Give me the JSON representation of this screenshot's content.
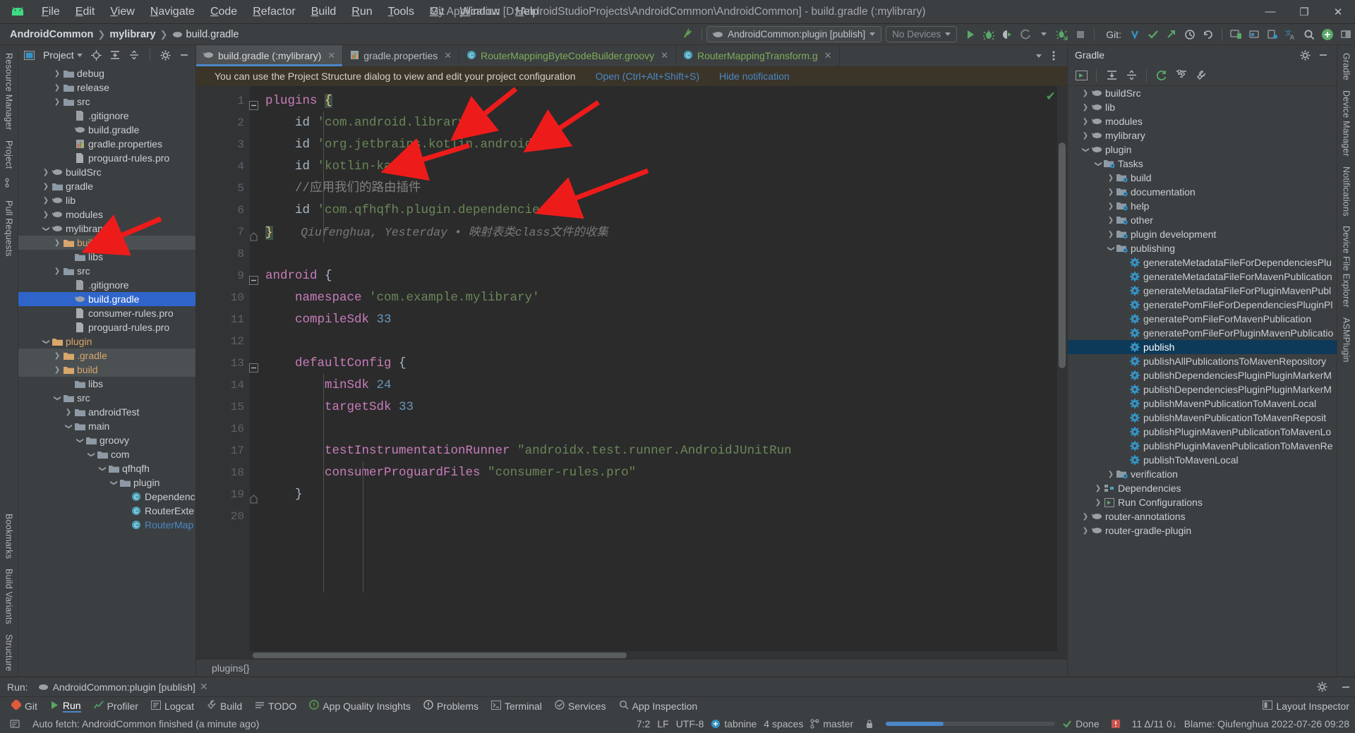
{
  "window": {
    "title": "My Application [D:\\AndroidStudioProjects\\AndroidCommon\\AndroidCommon] - build.gradle (:mylibrary)",
    "minimize": "—",
    "maximize": "❐",
    "close": "✕",
    "logo_icon": "android-logo-icon"
  },
  "menubar": [
    {
      "label": "File"
    },
    {
      "label": "Edit"
    },
    {
      "label": "View"
    },
    {
      "label": "Navigate"
    },
    {
      "label": "Code"
    },
    {
      "label": "Refactor"
    },
    {
      "label": "Build"
    },
    {
      "label": "Run"
    },
    {
      "label": "Tools"
    },
    {
      "label": "Git"
    },
    {
      "label": "Window"
    },
    {
      "label": "Help"
    }
  ],
  "breadcrumb": [
    {
      "label": "AndroidCommon"
    },
    {
      "label": "mylibrary"
    },
    {
      "label": "build.gradle"
    }
  ],
  "toolbar": {
    "run_config": "AndroidCommon:plugin [publish]",
    "devices": "No Devices",
    "git_label": "Git:",
    "icons": [
      "run-icon",
      "debug-icon",
      "run-coverage-icon",
      "profiler-icon",
      "attach-debugger-icon",
      "stop-icon",
      "git-update-icon",
      "git-commit-icon",
      "git-push-icon",
      "history-icon",
      "undo-icon",
      "search-everywhere-icon",
      "avd-manager-icon",
      "sdk-manager-icon",
      "translate-icon",
      "search-icon",
      "plus-icon",
      "layout-icon"
    ]
  },
  "left_rail": {
    "top": [
      "Resource Manager",
      "Project"
    ],
    "middle": [
      "Pull Requests"
    ],
    "bottom": [
      "Bookmarks",
      "Build Variants",
      "Structure"
    ]
  },
  "right_rail": [
    "Gradle",
    "Device Manager",
    "Notifications",
    "Device File Explorer",
    "ASMPlugin"
  ],
  "project_panel": {
    "title": "Project",
    "tree": [
      {
        "label": "debug",
        "indent": 3,
        "arrow": "collapsed",
        "icon": "folder-icon",
        "state": "normal"
      },
      {
        "label": "release",
        "indent": 3,
        "arrow": "collapsed",
        "icon": "folder-icon",
        "state": "normal"
      },
      {
        "label": "src",
        "indent": 3,
        "arrow": "collapsed",
        "icon": "folder-icon",
        "state": "normal"
      },
      {
        "label": ".gitignore",
        "indent": 4,
        "arrow": "none",
        "icon": "gitignore-icon",
        "state": "normal"
      },
      {
        "label": "build.gradle",
        "indent": 4,
        "arrow": "none",
        "icon": "gradle-icon",
        "state": "normal"
      },
      {
        "label": "gradle.properties",
        "indent": 4,
        "arrow": "none",
        "icon": "properties-icon",
        "state": "normal"
      },
      {
        "label": "proguard-rules.pro",
        "indent": 4,
        "arrow": "none",
        "icon": "file-icon",
        "state": "normal"
      },
      {
        "label": "buildSrc",
        "indent": 2,
        "arrow": "collapsed",
        "icon": "module-icon",
        "state": "normal"
      },
      {
        "label": "gradle",
        "indent": 2,
        "arrow": "collapsed",
        "icon": "folder-icon",
        "state": "normal"
      },
      {
        "label": "lib",
        "indent": 2,
        "arrow": "collapsed",
        "icon": "module-icon",
        "state": "normal"
      },
      {
        "label": "modules",
        "indent": 2,
        "arrow": "collapsed",
        "icon": "module-icon",
        "state": "normal"
      },
      {
        "label": "mylibrary",
        "indent": 2,
        "arrow": "expanded",
        "icon": "module-icon",
        "state": "normal"
      },
      {
        "label": "build",
        "indent": 3,
        "arrow": "collapsed",
        "icon": "folder-orange-icon",
        "state": "highlight"
      },
      {
        "label": "libs",
        "indent": 4,
        "arrow": "none",
        "icon": "folder-icon",
        "state": "normal"
      },
      {
        "label": "src",
        "indent": 3,
        "arrow": "collapsed",
        "icon": "folder-icon",
        "state": "normal"
      },
      {
        "label": ".gitignore",
        "indent": 4,
        "arrow": "none",
        "icon": "gitignore-icon",
        "state": "normal"
      },
      {
        "label": "build.gradle",
        "indent": 4,
        "arrow": "none",
        "icon": "gradle-icon",
        "state": "selected"
      },
      {
        "label": "consumer-rules.pro",
        "indent": 4,
        "arrow": "none",
        "icon": "file-icon",
        "state": "normal"
      },
      {
        "label": "proguard-rules.pro",
        "indent": 4,
        "arrow": "none",
        "icon": "file-icon",
        "state": "normal"
      },
      {
        "label": "plugin",
        "indent": 2,
        "arrow": "expanded",
        "icon": "folder-orange-icon",
        "state": "normal"
      },
      {
        "label": ".gradle",
        "indent": 3,
        "arrow": "collapsed",
        "icon": "folder-orange-icon",
        "state": "highlight"
      },
      {
        "label": "build",
        "indent": 3,
        "arrow": "collapsed",
        "icon": "folder-orange-icon",
        "state": "highlight"
      },
      {
        "label": "libs",
        "indent": 4,
        "arrow": "none",
        "icon": "folder-icon",
        "state": "normal"
      },
      {
        "label": "src",
        "indent": 3,
        "arrow": "expanded",
        "icon": "folder-icon",
        "state": "normal"
      },
      {
        "label": "androidTest",
        "indent": 4,
        "arrow": "collapsed",
        "icon": "folder-icon",
        "state": "normal"
      },
      {
        "label": "main",
        "indent": 4,
        "arrow": "expanded",
        "icon": "folder-icon",
        "state": "normal"
      },
      {
        "label": "groovy",
        "indent": 5,
        "arrow": "expanded",
        "icon": "folder-icon",
        "state": "normal"
      },
      {
        "label": "com",
        "indent": 6,
        "arrow": "expanded",
        "icon": "folder-icon",
        "state": "normal"
      },
      {
        "label": "qfhqfh",
        "indent": 7,
        "arrow": "expanded",
        "icon": "folder-icon",
        "state": "normal"
      },
      {
        "label": "plugin",
        "indent": 8,
        "arrow": "expanded",
        "icon": "folder-icon",
        "state": "normal"
      },
      {
        "label": "Dependenc",
        "indent": 9,
        "arrow": "none",
        "icon": "class-icon",
        "state": "normal"
      },
      {
        "label": "RouterExte",
        "indent": 9,
        "arrow": "none",
        "icon": "class-icon",
        "state": "normal"
      },
      {
        "label": "RouterMap",
        "indent": 9,
        "arrow": "none",
        "icon": "class-icon",
        "state": "link"
      }
    ]
  },
  "editor_tabs": [
    {
      "label": "build.gradle (:mylibrary)",
      "icon": "gradle-icon",
      "active": true,
      "color": "normal"
    },
    {
      "label": "gradle.properties",
      "icon": "properties-icon",
      "active": false,
      "color": "normal"
    },
    {
      "label": "RouterMappingByteCodeBuilder.groovy",
      "icon": "class-icon",
      "active": false,
      "color": "groovy"
    },
    {
      "label": "RouterMappingTransform.g",
      "icon": "class-icon",
      "active": false,
      "color": "groovy"
    }
  ],
  "notification": {
    "text": "You can use the Project Structure dialog to view and edit your project configuration",
    "open_link": "Open (Ctrl+Alt+Shift+S)",
    "hide_link": "Hide notification"
  },
  "code": {
    "lines": [
      {
        "n": "1",
        "segments": [
          {
            "t": "plugins ",
            "c": "pl"
          },
          {
            "t": "{",
            "c": "brace-hl"
          }
        ],
        "fold": "expanded"
      },
      {
        "n": "2",
        "segments": [
          {
            "t": "    id ",
            "c": "kw-id"
          },
          {
            "t": "'com.android.library'",
            "c": "str"
          }
        ]
      },
      {
        "n": "3",
        "segments": [
          {
            "t": "    id ",
            "c": "kw-id"
          },
          {
            "t": "'org.jetbrains.kotlin.android'",
            "c": "str"
          }
        ]
      },
      {
        "n": "4",
        "segments": [
          {
            "t": "    id ",
            "c": "kw-id"
          },
          {
            "t": "'kotlin-kapt'",
            "c": "str"
          }
        ]
      },
      {
        "n": "5",
        "segments": [
          {
            "t": "    //应用我们的路由插件",
            "c": "cmt"
          }
        ]
      },
      {
        "n": "6",
        "segments": [
          {
            "t": "    id ",
            "c": "kw-id"
          },
          {
            "t": "'com.qfhqfh.plugin.dependencies'",
            "c": "str"
          }
        ]
      },
      {
        "n": "7",
        "segments": [
          {
            "t": "}",
            "c": "brace-hl"
          },
          {
            "t": "    Qiufenghua, Yesterday • 映射表类class文件的收集",
            "c": "blame"
          }
        ],
        "fold": "end"
      },
      {
        "n": "8",
        "segments": []
      },
      {
        "n": "9",
        "segments": [
          {
            "t": "android ",
            "c": "pl"
          },
          {
            "t": "{",
            "c": "plain"
          }
        ],
        "fold": "expanded"
      },
      {
        "n": "10",
        "segments": [
          {
            "t": "    namespace ",
            "c": "pl"
          },
          {
            "t": "'com.example.mylibrary'",
            "c": "str"
          }
        ]
      },
      {
        "n": "11",
        "segments": [
          {
            "t": "    compileSdk ",
            "c": "pl"
          },
          {
            "t": "33",
            "c": "num"
          }
        ]
      },
      {
        "n": "12",
        "segments": []
      },
      {
        "n": "13",
        "segments": [
          {
            "t": "    defaultConfig ",
            "c": "pl"
          },
          {
            "t": "{",
            "c": "plain"
          }
        ],
        "fold": "expanded"
      },
      {
        "n": "14",
        "segments": [
          {
            "t": "        minSdk ",
            "c": "pl"
          },
          {
            "t": "24",
            "c": "num"
          }
        ]
      },
      {
        "n": "15",
        "segments": [
          {
            "t": "        targetSdk ",
            "c": "pl"
          },
          {
            "t": "33",
            "c": "num"
          }
        ]
      },
      {
        "n": "16",
        "segments": []
      },
      {
        "n": "17",
        "segments": [
          {
            "t": "        testInstrumentationRunner ",
            "c": "pl"
          },
          {
            "t": "\"androidx.test.runner.AndroidJUnitRun",
            "c": "str"
          }
        ]
      },
      {
        "n": "18",
        "segments": [
          {
            "t": "        consumerProguardFiles ",
            "c": "pl"
          },
          {
            "t": "\"consumer-rules.pro\"",
            "c": "str"
          }
        ]
      },
      {
        "n": "19",
        "segments": [
          {
            "t": "    }",
            "c": "plain"
          }
        ],
        "fold": "end"
      },
      {
        "n": "20",
        "segments": []
      }
    ],
    "breadcrumb": "plugins{}"
  },
  "gradle_panel": {
    "title": "Gradle",
    "tools": [
      "execute-task-icon",
      "expand-all-icon",
      "collapse-all-icon",
      "sync-icon",
      "filter-icon",
      "build-tools-icon",
      "settings-icon",
      "hide-icon"
    ],
    "tree": [
      {
        "label": "buildSrc",
        "indent": 1,
        "arrow": "collapsed",
        "icon": "gradle-icon",
        "state": "normal"
      },
      {
        "label": "lib",
        "indent": 1,
        "arrow": "collapsed",
        "icon": "gradle-icon",
        "state": "normal"
      },
      {
        "label": "modules",
        "indent": 1,
        "arrow": "collapsed",
        "icon": "gradle-icon",
        "state": "normal"
      },
      {
        "label": "mylibrary",
        "indent": 1,
        "arrow": "collapsed",
        "icon": "gradle-icon",
        "state": "normal"
      },
      {
        "label": "plugin",
        "indent": 1,
        "arrow": "expanded",
        "icon": "gradle-icon",
        "state": "normal"
      },
      {
        "label": "Tasks",
        "indent": 2,
        "arrow": "expanded",
        "icon": "taskfolder-icon",
        "state": "normal"
      },
      {
        "label": "build",
        "indent": 3,
        "arrow": "collapsed",
        "icon": "taskfolder-icon",
        "state": "normal"
      },
      {
        "label": "documentation",
        "indent": 3,
        "arrow": "collapsed",
        "icon": "taskfolder-icon",
        "state": "normal"
      },
      {
        "label": "help",
        "indent": 3,
        "arrow": "collapsed",
        "icon": "taskfolder-icon",
        "state": "normal"
      },
      {
        "label": "other",
        "indent": 3,
        "arrow": "collapsed",
        "icon": "taskfolder-icon",
        "state": "normal"
      },
      {
        "label": "plugin development",
        "indent": 3,
        "arrow": "collapsed",
        "icon": "taskfolder-icon",
        "state": "normal"
      },
      {
        "label": "publishing",
        "indent": 3,
        "arrow": "expanded",
        "icon": "taskfolder-icon",
        "state": "normal"
      },
      {
        "label": "generateMetadataFileForDependenciesPlu",
        "indent": 4,
        "arrow": "none",
        "icon": "task-icon",
        "state": "normal"
      },
      {
        "label": "generateMetadataFileForMavenPublication",
        "indent": 4,
        "arrow": "none",
        "icon": "task-icon",
        "state": "normal"
      },
      {
        "label": "generateMetadataFileForPluginMavenPubl",
        "indent": 4,
        "arrow": "none",
        "icon": "task-icon",
        "state": "normal"
      },
      {
        "label": "generatePomFileForDependenciesPluginPl",
        "indent": 4,
        "arrow": "none",
        "icon": "task-icon",
        "state": "normal"
      },
      {
        "label": "generatePomFileForMavenPublication",
        "indent": 4,
        "arrow": "none",
        "icon": "task-icon",
        "state": "normal"
      },
      {
        "label": "generatePomFileForPluginMavenPublicatio",
        "indent": 4,
        "arrow": "none",
        "icon": "task-icon",
        "state": "normal"
      },
      {
        "label": "publish",
        "indent": 4,
        "arrow": "none",
        "icon": "task-icon",
        "state": "selected"
      },
      {
        "label": "publishAllPublicationsToMavenRepository",
        "indent": 4,
        "arrow": "none",
        "icon": "task-icon",
        "state": "normal"
      },
      {
        "label": "publishDependenciesPluginPluginMarkerM",
        "indent": 4,
        "arrow": "none",
        "icon": "task-icon",
        "state": "normal"
      },
      {
        "label": "publishDependenciesPluginPluginMarkerM",
        "indent": 4,
        "arrow": "none",
        "icon": "task-icon",
        "state": "normal"
      },
      {
        "label": "publishMavenPublicationToMavenLocal",
        "indent": 4,
        "arrow": "none",
        "icon": "task-icon",
        "state": "normal"
      },
      {
        "label": "publishMavenPublicationToMavenReposit",
        "indent": 4,
        "arrow": "none",
        "icon": "task-icon",
        "state": "normal"
      },
      {
        "label": "publishPluginMavenPublicationToMavenLo",
        "indent": 4,
        "arrow": "none",
        "icon": "task-icon",
        "state": "normal"
      },
      {
        "label": "publishPluginMavenPublicationToMavenRe",
        "indent": 4,
        "arrow": "none",
        "icon": "task-icon",
        "state": "normal"
      },
      {
        "label": "publishToMavenLocal",
        "indent": 4,
        "arrow": "none",
        "icon": "task-icon",
        "state": "normal"
      },
      {
        "label": "verification",
        "indent": 3,
        "arrow": "collapsed",
        "icon": "taskfolder-icon",
        "state": "normal"
      },
      {
        "label": "Dependencies",
        "indent": 2,
        "arrow": "collapsed",
        "icon": "deps-icon",
        "state": "normal"
      },
      {
        "label": "Run Configurations",
        "indent": 2,
        "arrow": "collapsed",
        "icon": "runcfg-icon",
        "state": "normal"
      },
      {
        "label": "router-annotations",
        "indent": 1,
        "arrow": "collapsed",
        "icon": "gradle-icon",
        "state": "normal"
      },
      {
        "label": "router-gradle-plugin",
        "indent": 1,
        "arrow": "collapsed",
        "icon": "gradle-icon",
        "state": "normal"
      }
    ]
  },
  "run_panel": {
    "label": "Run:",
    "tab": "AndroidCommon:plugin [publish]",
    "tab_icon": "gradle-icon",
    "close": "✕"
  },
  "tool_windows": [
    {
      "label": "Git",
      "icon": "git-icon"
    },
    {
      "label": "Run",
      "icon": "run-icon",
      "active": true
    },
    {
      "label": "Profiler",
      "icon": "profiler-icon"
    },
    {
      "label": "Logcat",
      "icon": "logcat-icon"
    },
    {
      "label": "Build",
      "icon": "build-icon"
    },
    {
      "label": "TODO",
      "icon": "todo-icon"
    },
    {
      "label": "App Quality Insights",
      "icon": "insights-icon"
    },
    {
      "label": "Problems",
      "icon": "problems-icon"
    },
    {
      "label": "Terminal",
      "icon": "terminal-icon"
    },
    {
      "label": "Services",
      "icon": "services-icon"
    },
    {
      "label": "App Inspection",
      "icon": "inspection-icon"
    }
  ],
  "layout_inspector": "Layout Inspector",
  "statusbar": {
    "message": "Auto fetch: AndroidCommon finished (a minute ago)",
    "caret": "7:2",
    "line_sep": "LF",
    "encoding": "UTF-8",
    "tabnine": "tabnine",
    "indent": "4 spaces",
    "branch": "master",
    "done": "Done",
    "git_stats": "11 Δ/11 0↓",
    "blame": "Blame: Qiufenghua 2022-07-26 09:28",
    "lock_icon": "lock-icon",
    "event_icon": "event-log-icon",
    "inspection_icon": "inspection-widget-icon"
  },
  "colors": {
    "accent_blue": "#4a88c7",
    "selection_blue": "#2f65ca",
    "string_green": "#6a8759",
    "keyword_orange": "#cc7832",
    "number_blue": "#6897bb",
    "arrow_red": "#ee1b1b",
    "notification_bg": "#3b3428",
    "panel_bg": "#3c3f41",
    "editor_bg": "#2b2b2b"
  },
  "annotation_arrows": [
    {
      "name": "arrow-to-android-library"
    },
    {
      "name": "arrow-to-kotlin-android"
    },
    {
      "name": "arrow-to-kotlin-kapt"
    },
    {
      "name": "arrow-to-dependencies-plugin"
    },
    {
      "name": "arrow-to-mylibrary-build"
    }
  ]
}
